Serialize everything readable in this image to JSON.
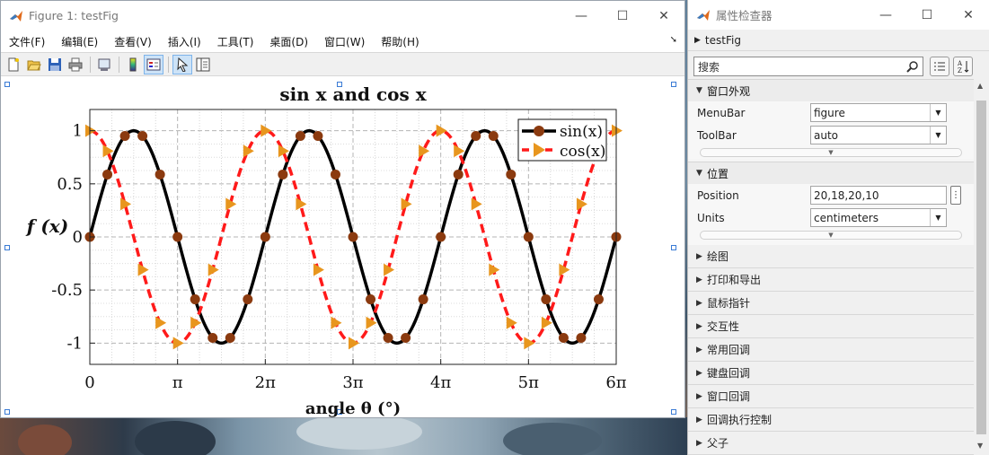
{
  "figure_window": {
    "title": "Figure 1: testFig",
    "menu": [
      "文件(F)",
      "编辑(E)",
      "查看(V)",
      "插入(I)",
      "工具(T)",
      "桌面(D)",
      "窗口(W)",
      "帮助(H)"
    ],
    "toolbar_icons": [
      "new-figure-icon",
      "open-icon",
      "save-icon",
      "print-icon",
      "link-plot-icon",
      "colorbar-icon",
      "legend-icon",
      "edit-plot-icon",
      "property-inspector-icon"
    ]
  },
  "chart_data": {
    "type": "line",
    "title": "sin x and cos x",
    "xlabel": "angle θ (°)",
    "ylabel": "f (x)",
    "xlim": [
      0,
      18.8496
    ],
    "ylim": [
      -1.2,
      1.2
    ],
    "xticks": [
      "0",
      "π",
      "2π",
      "3π",
      "4π",
      "5π",
      "6π"
    ],
    "yticks": [
      "1",
      "0.5",
      "0",
      "-0.5",
      "-1"
    ],
    "grid": true,
    "legend_position": "top-right",
    "series": [
      {
        "name": "sin(x)",
        "function": "sin",
        "color": "#000000",
        "marker": "circle",
        "marker_color": "#8b3a0f"
      },
      {
        "name": "cos(x)",
        "function": "cos",
        "color": "#ff1a1a",
        "marker": "triangle-right",
        "marker_color": "#e8961e"
      }
    ]
  },
  "inspector": {
    "title": "属性检查器",
    "object": "testFig",
    "search_placeholder": "搜索",
    "sections": [
      {
        "label": "窗口外观",
        "props": [
          {
            "name": "MenuBar",
            "value": "figure"
          },
          {
            "name": "ToolBar",
            "value": "auto"
          }
        ]
      },
      {
        "label": "位置",
        "props": [
          {
            "name": "Position",
            "value": "20,18,20,10"
          },
          {
            "name": "Units",
            "value": "centimeters"
          }
        ]
      }
    ],
    "collapsed": [
      "绘图",
      "打印和导出",
      "鼠标指针",
      "交互性",
      "常用回调",
      "键盘回调",
      "窗口回调",
      "回调执行控制",
      "父子"
    ]
  }
}
